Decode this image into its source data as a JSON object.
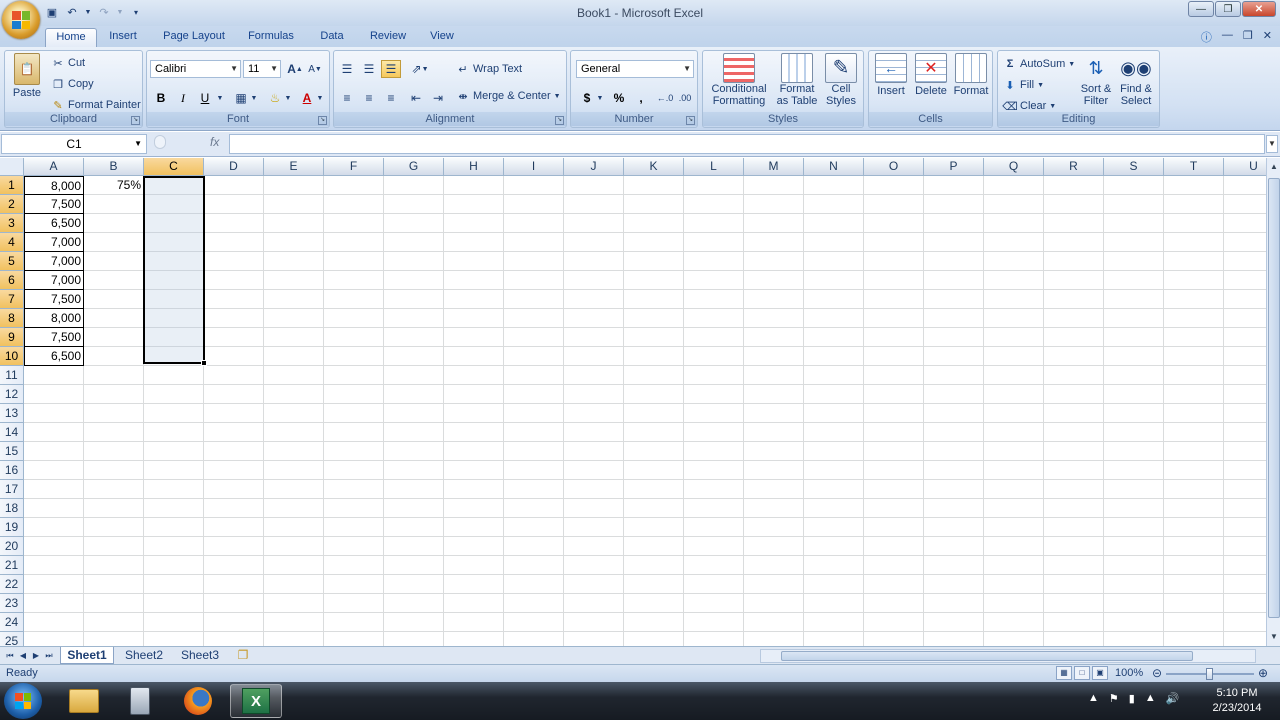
{
  "window": {
    "title": "Book1 - Microsoft Excel"
  },
  "ribbon_tabs": [
    "Home",
    "Insert",
    "Page Layout",
    "Formulas",
    "Data",
    "Review",
    "View"
  ],
  "clipboard": {
    "paste": "Paste",
    "cut": "Cut",
    "copy": "Copy",
    "format_painter": "Format Painter",
    "label": "Clipboard"
  },
  "font": {
    "name": "Calibri",
    "size": "11",
    "bold": "B",
    "italic": "I",
    "underline": "U",
    "label": "Font"
  },
  "alignment": {
    "wrap_text": "Wrap Text",
    "merge_center": "Merge & Center",
    "label": "Alignment"
  },
  "number": {
    "format": "General",
    "currency": "$",
    "percent": "%",
    "comma": ",",
    "label": "Number"
  },
  "styles": {
    "conditional_formatting": "Conditional Formatting",
    "format_as_table": "Format as Table",
    "cell_styles": "Cell Styles",
    "label": "Styles"
  },
  "cells": {
    "insert": "Insert",
    "delete": "Delete",
    "format": "Format",
    "label": "Cells"
  },
  "editing": {
    "autosum": "AutoSum",
    "fill": "Fill",
    "clear": "Clear",
    "sort_filter": "Sort & Filter",
    "find_select": "Find & Select",
    "label": "Editing"
  },
  "formula_bar": {
    "name_box": "C1",
    "fx": "fx",
    "formula": ""
  },
  "grid": {
    "columns": [
      "A",
      "B",
      "C",
      "D",
      "E",
      "F",
      "G",
      "H",
      "I",
      "J",
      "K",
      "L",
      "M",
      "N",
      "O",
      "P",
      "Q",
      "R",
      "S",
      "T",
      "U"
    ],
    "rows": [
      "1",
      "2",
      "3",
      "4",
      "5",
      "6",
      "7",
      "8",
      "9",
      "10",
      "11",
      "12",
      "13",
      "14",
      "15",
      "16",
      "17",
      "18",
      "19",
      "20",
      "21",
      "22",
      "23",
      "24",
      "25"
    ],
    "column_a": [
      "8,000",
      "7,500",
      "6,500",
      "7,000",
      "7,000",
      "7,000",
      "7,500",
      "8,000",
      "7,500",
      "6,500"
    ],
    "b1": "75%",
    "selected_column": "C",
    "selected_range": "C1:C10"
  },
  "sheets": [
    "Sheet1",
    "Sheet2",
    "Sheet3"
  ],
  "active_sheet": "Sheet1",
  "status": {
    "text": "Ready",
    "zoom": "100%",
    "zoom_level": 1.0
  },
  "taskbar": {
    "time": "5:10 PM",
    "date": "2/23/2014",
    "apps": [
      "windows-explorer",
      "calculator",
      "firefox",
      "excel"
    ]
  },
  "colors": {
    "accent": "#15428b",
    "selected_header": "#f1c15f",
    "excel_green": "#1e7145"
  }
}
